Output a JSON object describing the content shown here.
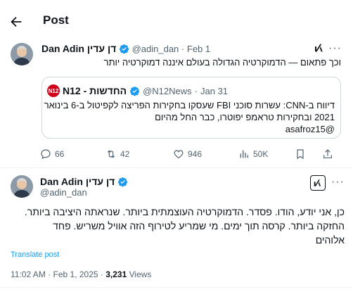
{
  "header": {
    "title": "Post"
  },
  "post1": {
    "author_name": "Dan Adin דן עדין",
    "handle": "@adin_dan",
    "dot": "·",
    "date": "Feb 1",
    "text": "וכך פתאום — הדמוקרטיה הגדולה בעולם איננה דמוקרטיה יותר",
    "quote": {
      "author_name": "N12 - החדשות",
      "handle": "@N12News",
      "dot": "·",
      "date": "Jan 31",
      "line1": "דיווח ב-CNN: עשרות סוכני FBI שעסקו בחקירות הפריצה לקפיטול ב-6 בינואר",
      "line2": "2021 ובחקירות טראמפ יפוטרו, כבר החל מהיום",
      "line3": "@asafroz15"
    },
    "actions": {
      "replies": "66",
      "reposts": "42",
      "likes": "946",
      "views": "50K"
    }
  },
  "post2": {
    "author_name": "Dan Adin דן עדין",
    "handle": "@adin_dan",
    "line1": "כן, אני יודע, הודו. פסדר. הדמוקרטיה העוצמתית ביותר. שנראתה היציבה ביותר.",
    "line2": "החזקה ביותר. קרסה תוך ימים. מי שמריע לטירוף הזה אוויל משריש. פחד",
    "line3": "אלוהים",
    "translate": "Translate post",
    "time": "11:02 AM",
    "sep1": "·",
    "date": "Feb 1, 2025",
    "sep2": "·",
    "views_count": "3,231",
    "views_label": "Views"
  },
  "colors": {
    "accent": "#1d9bf0",
    "muted": "#536471",
    "n12_red": "#d0021b"
  },
  "icons": [
    "back-arrow-icon",
    "grok-icon",
    "verified-badge-icon",
    "reply-icon",
    "repost-icon",
    "like-icon",
    "views-icon",
    "bookmark-icon",
    "share-icon"
  ]
}
